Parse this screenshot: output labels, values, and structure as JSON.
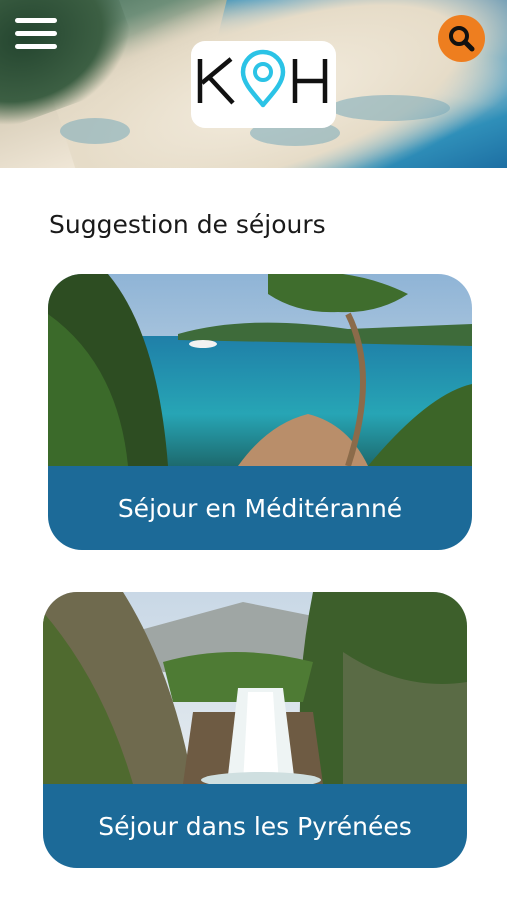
{
  "header": {
    "menu_icon": "hamburger-menu-icon",
    "search_icon": "search-icon",
    "logo_text": "KOH",
    "colors": {
      "search_button": "#ee7e1f",
      "logo_pin": "#2bc3e6"
    }
  },
  "main": {
    "section_title": "Suggestion de séjours",
    "cards": [
      {
        "label": "Séjour en Méditéranné"
      },
      {
        "label": "Séjour dans les Pyrénées"
      }
    ]
  },
  "colors": {
    "card_label_background": "#1c6a98",
    "card_label_text": "#ffffff"
  }
}
